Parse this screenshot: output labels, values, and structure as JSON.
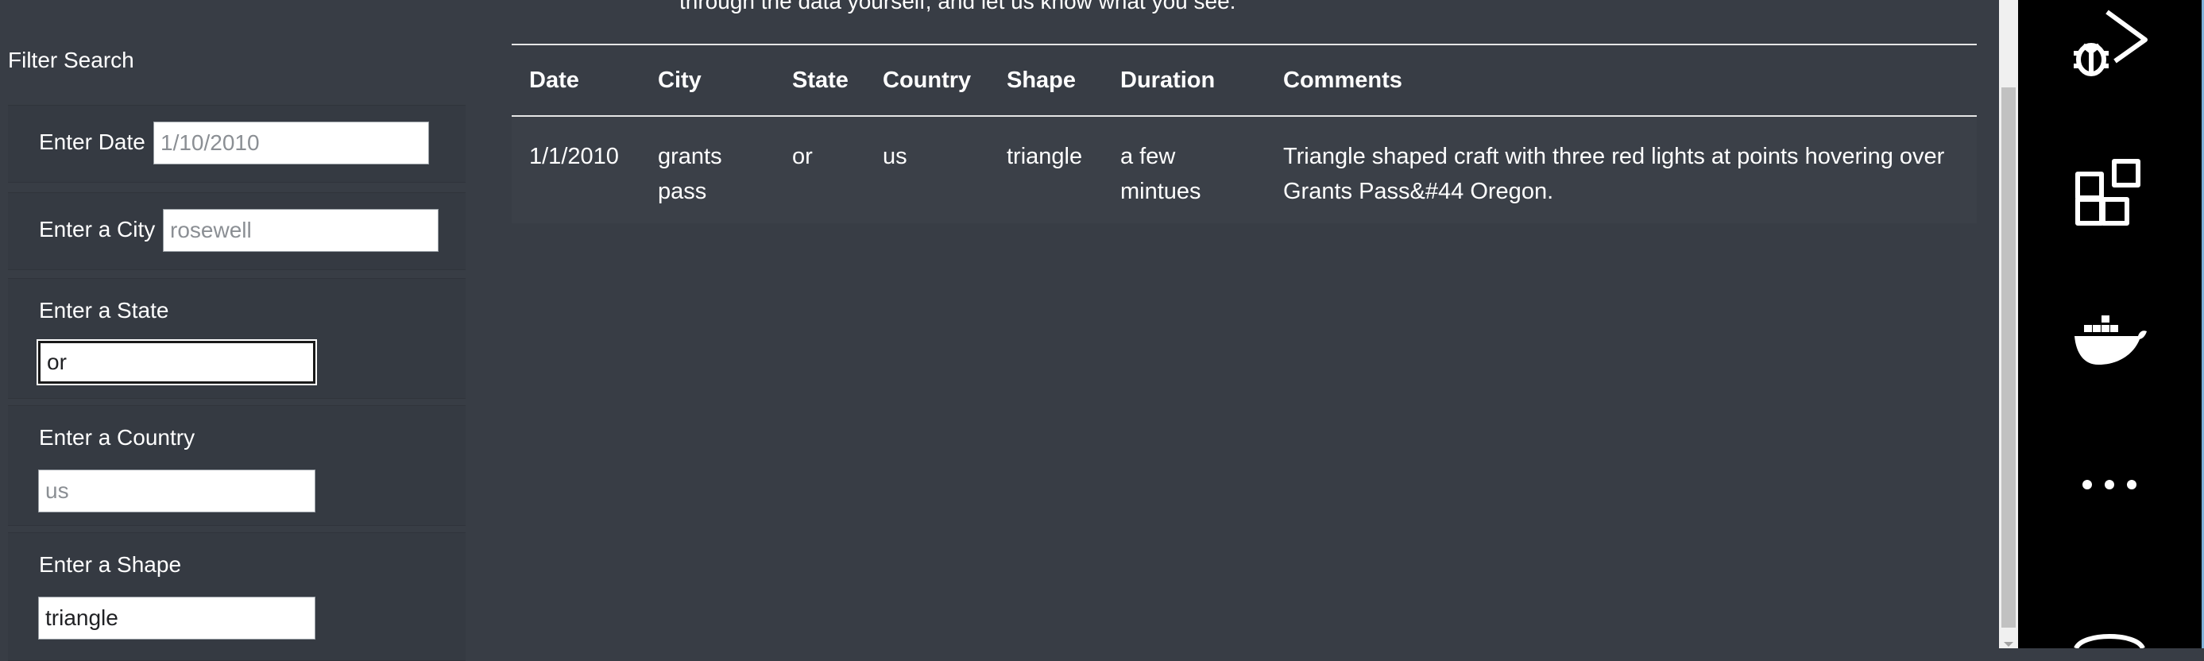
{
  "intro": {
    "text": "through the data yourself, and let us know what you see."
  },
  "filter": {
    "title": "Filter Search",
    "date": {
      "label": "Enter Date",
      "value": "",
      "placeholder": "1/10/2010"
    },
    "city": {
      "label": "Enter a City",
      "value": "",
      "placeholder": "rosewell"
    },
    "state": {
      "label": "Enter a State",
      "value": "or",
      "placeholder": ""
    },
    "country": {
      "label": "Enter a Country",
      "value": "",
      "placeholder": "us"
    },
    "shape": {
      "label": "Enter a Shape",
      "value": "triangle",
      "placeholder": ""
    }
  },
  "table": {
    "headers": [
      "Date",
      "City",
      "State",
      "Country",
      "Shape",
      "Duration",
      "Comments"
    ],
    "rows": [
      {
        "date": "1/1/2010",
        "city": "grants pass",
        "state": "or",
        "country": "us",
        "shape": "triangle",
        "duration": "a few mintues",
        "comments": "Triangle shaped craft with three red lights at points hovering over Grants Pass&#44 Oregon."
      }
    ]
  },
  "activity_bar": {
    "icons": [
      "run-and-debug-icon",
      "extensions-icon",
      "docker-icon",
      "more-icon",
      "account-icon"
    ]
  },
  "colors": {
    "background": "#383d45",
    "activity_bar": "#000000",
    "accent_edge": "#7fb2d9"
  }
}
